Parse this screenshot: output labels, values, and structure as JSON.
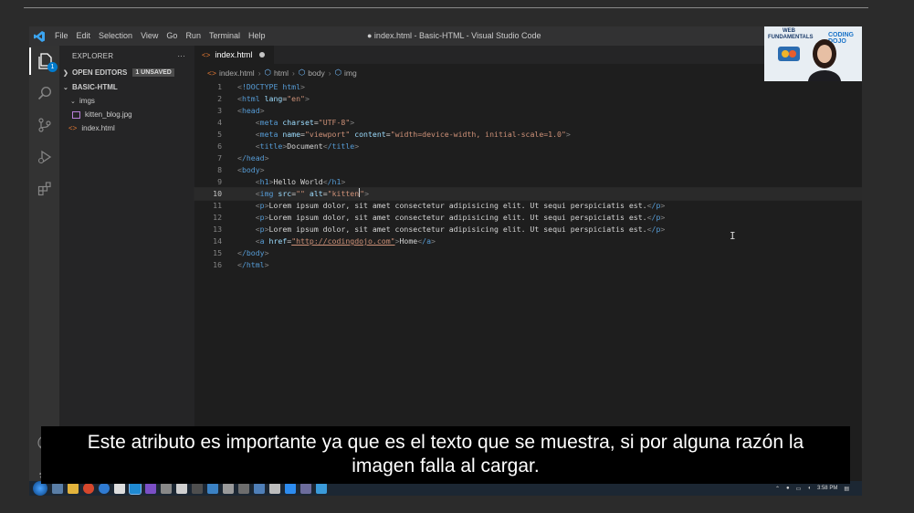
{
  "window": {
    "title": "● index.html - Basic-HTML - Visual Studio Code",
    "menu": [
      "File",
      "Edit",
      "Selection",
      "View",
      "Go",
      "Run",
      "Terminal",
      "Help"
    ]
  },
  "activity_bar": {
    "explorer_badge": "1"
  },
  "sidebar": {
    "header": "EXPLORER",
    "more": "···",
    "open_editors": "OPEN EDITORS",
    "unsaved": "1 UNSAVED",
    "project": "BASIC-HTML",
    "folder": "imgs",
    "folder_file": "kitten_blog.jpg",
    "root_file": "index.html"
  },
  "editor": {
    "tab_label": "index.html",
    "breadcrumb": [
      "index.html",
      "html",
      "body",
      "img"
    ],
    "current_line": 10,
    "lines": [
      "<!DOCTYPE html>",
      "<html lang=\"en\">",
      "<head>",
      "    <meta charset=\"UTF-8\">",
      "    <meta name=\"viewport\" content=\"width=device-width, initial-scale=1.0\">",
      "    <title>Document</title>",
      "</head>",
      "<body>",
      "    <h1>Hello World</h1>",
      "    <img src=\"\" alt=\"kitten\">",
      "    <p>Lorem ipsum dolor, sit amet consectetur adipisicing elit. Ut sequi perspiciatis est.</p>",
      "    <p>Lorem ipsum dolor, sit amet consectetur adipisicing elit. Ut sequi perspiciatis est.</p>",
      "    <p>Lorem ipsum dolor, sit amet consectetur adipisicing elit. Ut sequi perspiciatis est.</p>",
      "    <a href=\"http://codingdojo.com\">Home</a>",
      "</body>",
      "</html>"
    ]
  },
  "webcam": {
    "overlay_title": "WEB FUNDAMENTALS",
    "logo_text": "CODING DOJO"
  },
  "taskbar": {
    "clock": "3:58 PM"
  },
  "subtitle": {
    "line1": "Este atributo es importante ya que es el texto que se muestra, si por alguna razón la",
    "line2": "imagen falla al cargar."
  },
  "colors": {
    "accent": "#007acc",
    "editor_bg": "#1e1e1e",
    "sidebar_bg": "#252526",
    "tag": "#569cd6",
    "attr": "#9cdcfe",
    "string": "#ce9178"
  }
}
